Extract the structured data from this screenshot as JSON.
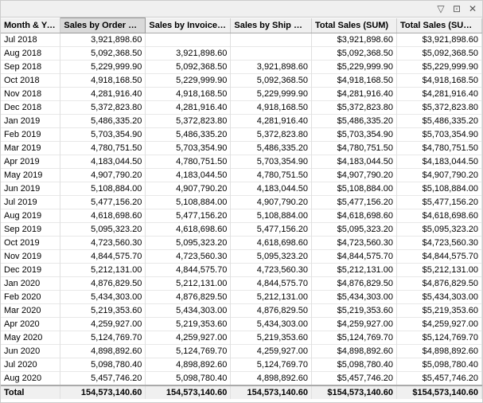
{
  "toolbar": {
    "filter_icon": "▽",
    "expand_icon": "⊞",
    "close_icon": "✕"
  },
  "columns": [
    {
      "id": "month_year",
      "label": "Month & Year",
      "sort": null
    },
    {
      "id": "sales_order",
      "label": "Sales by Order Date",
      "sort": "down",
      "active": true
    },
    {
      "id": "sales_invoice",
      "label": "Sales by Invoice Date",
      "sort": null
    },
    {
      "id": "sales_ship",
      "label": "Sales by Ship Date",
      "sort": null
    },
    {
      "id": "total_sum",
      "label": "Total Sales (SUM)",
      "sort": null
    },
    {
      "id": "total_sumx",
      "label": "Total Sales (SUMX)",
      "sort": null
    }
  ],
  "rows": [
    {
      "month": "Jul 2018",
      "order": "3,921,898.60",
      "invoice": "",
      "ship": "",
      "total_sum": "$3,921,898.60",
      "total_sumx": "$3,921,898.60"
    },
    {
      "month": "Aug 2018",
      "order": "5,092,368.50",
      "invoice": "3,921,898.60",
      "ship": "",
      "total_sum": "$5,092,368.50",
      "total_sumx": "$5,092,368.50"
    },
    {
      "month": "Sep 2018",
      "order": "5,229,999.90",
      "invoice": "5,092,368.50",
      "ship": "3,921,898.60",
      "total_sum": "$5,229,999.90",
      "total_sumx": "$5,229,999.90"
    },
    {
      "month": "Oct 2018",
      "order": "4,918,168.50",
      "invoice": "5,229,999.90",
      "ship": "5,092,368.50",
      "total_sum": "$4,918,168.50",
      "total_sumx": "$4,918,168.50"
    },
    {
      "month": "Nov 2018",
      "order": "4,281,916.40",
      "invoice": "4,918,168.50",
      "ship": "5,229,999.90",
      "total_sum": "$4,281,916.40",
      "total_sumx": "$4,281,916.40"
    },
    {
      "month": "Dec 2018",
      "order": "5,372,823.80",
      "invoice": "4,281,916.40",
      "ship": "4,918,168.50",
      "total_sum": "$5,372,823.80",
      "total_sumx": "$5,372,823.80"
    },
    {
      "month": "Jan 2019",
      "order": "5,486,335.20",
      "invoice": "5,372,823.80",
      "ship": "4,281,916.40",
      "total_sum": "$5,486,335.20",
      "total_sumx": "$5,486,335.20"
    },
    {
      "month": "Feb 2019",
      "order": "5,703,354.90",
      "invoice": "5,486,335.20",
      "ship": "5,372,823.80",
      "total_sum": "$5,703,354.90",
      "total_sumx": "$5,703,354.90"
    },
    {
      "month": "Mar 2019",
      "order": "4,780,751.50",
      "invoice": "5,703,354.90",
      "ship": "5,486,335.20",
      "total_sum": "$4,780,751.50",
      "total_sumx": "$4,780,751.50"
    },
    {
      "month": "Apr 2019",
      "order": "4,183,044.50",
      "invoice": "4,780,751.50",
      "ship": "5,703,354.90",
      "total_sum": "$4,183,044.50",
      "total_sumx": "$4,183,044.50"
    },
    {
      "month": "May 2019",
      "order": "4,907,790.20",
      "invoice": "4,183,044.50",
      "ship": "4,780,751.50",
      "total_sum": "$4,907,790.20",
      "total_sumx": "$4,907,790.20"
    },
    {
      "month": "Jun 2019",
      "order": "5,108,884.00",
      "invoice": "4,907,790.20",
      "ship": "4,183,044.50",
      "total_sum": "$5,108,884.00",
      "total_sumx": "$5,108,884.00"
    },
    {
      "month": "Jul 2019",
      "order": "5,477,156.20",
      "invoice": "5,108,884.00",
      "ship": "4,907,790.20",
      "total_sum": "$5,477,156.20",
      "total_sumx": "$5,477,156.20"
    },
    {
      "month": "Aug 2019",
      "order": "4,618,698.60",
      "invoice": "5,477,156.20",
      "ship": "5,108,884.00",
      "total_sum": "$4,618,698.60",
      "total_sumx": "$4,618,698.60"
    },
    {
      "month": "Sep 2019",
      "order": "5,095,323.20",
      "invoice": "4,618,698.60",
      "ship": "5,477,156.20",
      "total_sum": "$5,095,323.20",
      "total_sumx": "$5,095,323.20"
    },
    {
      "month": "Oct 2019",
      "order": "4,723,560.30",
      "invoice": "5,095,323.20",
      "ship": "4,618,698.60",
      "total_sum": "$4,723,560.30",
      "total_sumx": "$4,723,560.30"
    },
    {
      "month": "Nov 2019",
      "order": "4,844,575.70",
      "invoice": "4,723,560.30",
      "ship": "5,095,323.20",
      "total_sum": "$4,844,575.70",
      "total_sumx": "$4,844,575.70"
    },
    {
      "month": "Dec 2019",
      "order": "5,212,131.00",
      "invoice": "4,844,575.70",
      "ship": "4,723,560.30",
      "total_sum": "$5,212,131.00",
      "total_sumx": "$5,212,131.00"
    },
    {
      "month": "Jan 2020",
      "order": "4,876,829.50",
      "invoice": "5,212,131.00",
      "ship": "4,844,575.70",
      "total_sum": "$4,876,829.50",
      "total_sumx": "$4,876,829.50"
    },
    {
      "month": "Feb 2020",
      "order": "5,434,303.00",
      "invoice": "4,876,829.50",
      "ship": "5,212,131.00",
      "total_sum": "$5,434,303.00",
      "total_sumx": "$5,434,303.00"
    },
    {
      "month": "Mar 2020",
      "order": "5,219,353.60",
      "invoice": "5,434,303.00",
      "ship": "4,876,829.50",
      "total_sum": "$5,219,353.60",
      "total_sumx": "$5,219,353.60"
    },
    {
      "month": "Apr 2020",
      "order": "4,259,927.00",
      "invoice": "5,219,353.60",
      "ship": "5,434,303.00",
      "total_sum": "$4,259,927.00",
      "total_sumx": "$4,259,927.00"
    },
    {
      "month": "May 2020",
      "order": "5,124,769.70",
      "invoice": "4,259,927.00",
      "ship": "5,219,353.60",
      "total_sum": "$5,124,769.70",
      "total_sumx": "$5,124,769.70"
    },
    {
      "month": "Jun 2020",
      "order": "4,898,892.60",
      "invoice": "5,124,769.70",
      "ship": "4,259,927.00",
      "total_sum": "$4,898,892.60",
      "total_sumx": "$4,898,892.60"
    },
    {
      "month": "Jul 2020",
      "order": "5,098,780.40",
      "invoice": "4,898,892.60",
      "ship": "5,124,769.70",
      "total_sum": "$5,098,780.40",
      "total_sumx": "$5,098,780.40"
    },
    {
      "month": "Aug 2020",
      "order": "5,457,746.20",
      "invoice": "5,098,780.40",
      "ship": "4,898,892.60",
      "total_sum": "$5,457,746.20",
      "total_sumx": "$5,457,746.20"
    }
  ],
  "total_row": {
    "label": "Total",
    "order": "154,573,140.60",
    "invoice": "154,573,140.60",
    "ship": "154,573,140.60",
    "total_sum": "$154,573,140.60",
    "total_sumx": "$154,573,140.60"
  }
}
